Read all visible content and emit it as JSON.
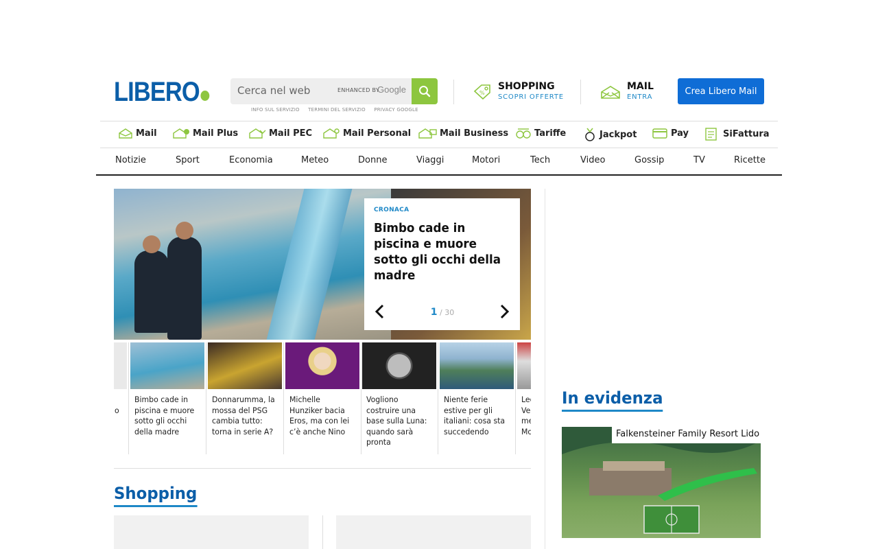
{
  "header": {
    "logo": "LIBERO",
    "search_placeholder": "Cerca nel web",
    "enhanced_by": "ENHANCED BY",
    "google": "Google",
    "links": [
      "INFO SUL SERVIZIO",
      "TERMINI DEL SERVIZIO",
      "PRIVACY GOOGLE"
    ],
    "shopping": {
      "title": "SHOPPING",
      "sub": "SCOPRI OFFERTE"
    },
    "mail": {
      "title": "MAIL",
      "sub": "ENTRA"
    },
    "cta": "Crea Libero Mail"
  },
  "services": [
    "Mail",
    "Mail Plus",
    "Mail PEC",
    "Mail Personal",
    "Mail Business",
    "Tariffe",
    "Jackpot",
    "Pay",
    "SiFattura"
  ],
  "sections": [
    "Notizie",
    "Sport",
    "Economia",
    "Meteo",
    "Donne",
    "Viaggi",
    "Motori",
    "Tech",
    "Video",
    "Gossip",
    "TV",
    "Ricette"
  ],
  "hero": {
    "category": "CRONACA",
    "title": "Bimbo cade in piscina e muore sotto gli occhi della madre",
    "current": "1",
    "total": "/ 30",
    "prev": "‹",
    "next": "›"
  },
  "thumbs": [
    {
      "text": "o"
    },
    {
      "text": "Bimbo cade in piscina e muore sotto gli occhi della madre"
    },
    {
      "text": "Donnarumma, la mossa del PSG cambia tutto: torna in serie A?"
    },
    {
      "text": "Michelle Hunziker bacia Eros, ma con lei c’è anche Nino"
    },
    {
      "text": "Vogliono costruire una base sulla Luna: quando sarà pronta"
    },
    {
      "text": "Niente ferie estive per gli italiani: cosa sta succedendo"
    },
    {
      "text": "Leo Ve me Mo"
    }
  ],
  "shopping_heading": "Shopping",
  "evidenza": {
    "heading": "In evidenza",
    "caption": "Falkensteiner Family Resort Lido"
  },
  "colors": {
    "brand": "#0b5ea8",
    "accent": "#8dc63f",
    "link": "#1e88c7",
    "cta": "#0f6dd6"
  }
}
